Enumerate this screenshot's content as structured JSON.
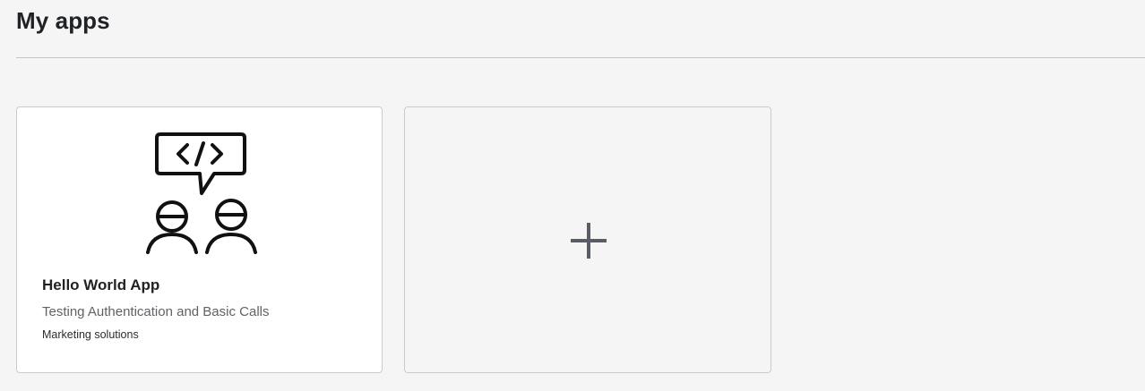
{
  "header": {
    "title": "My apps"
  },
  "apps": [
    {
      "name": "Hello World App",
      "description": "Testing Authentication and Basic Calls",
      "category": "Marketing solutions",
      "icon": "developers-chat-icon"
    }
  ],
  "add_app": {
    "icon": "plus-icon"
  },
  "colors": {
    "background": "#f4f5f4",
    "card_border": "#c9cbcd",
    "plus": "#5a5d66",
    "icon_stroke": "#111111"
  }
}
